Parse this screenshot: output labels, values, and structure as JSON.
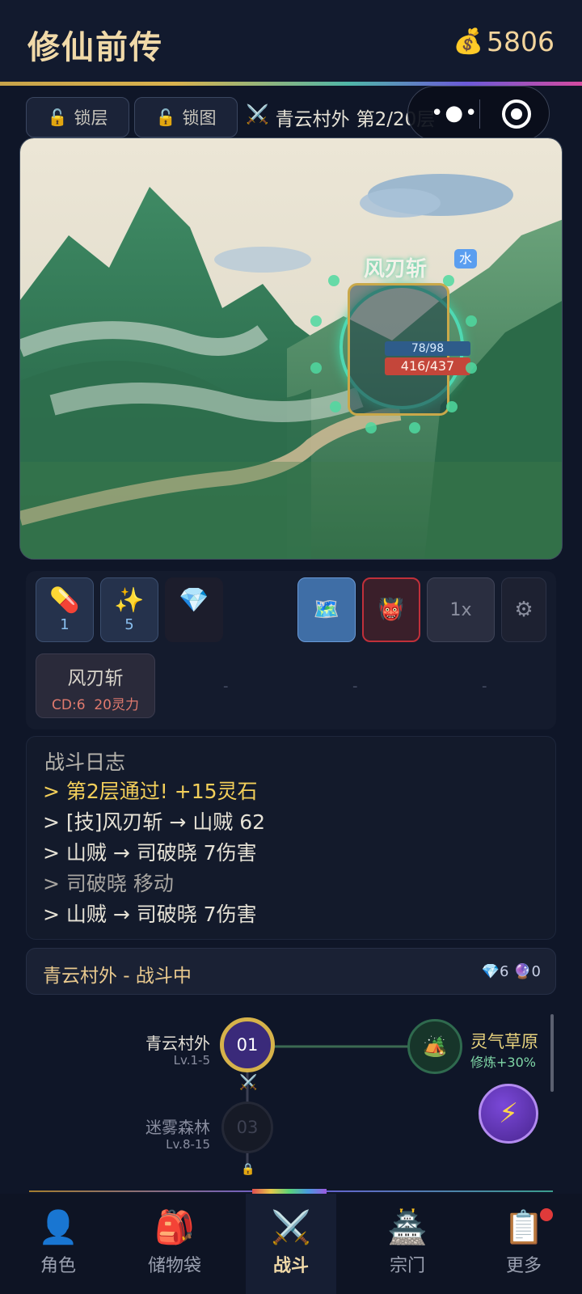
{
  "header": {
    "title": "修仙前传",
    "coin_icon": "money-bag-icon",
    "coins": "5806"
  },
  "top_controls": {
    "lock_floor": "锁层",
    "lock_map": "锁图",
    "stage_name": "青云村外",
    "stage_progress": "第2/20层"
  },
  "scene": {
    "skill_text": "风刃斩",
    "element": "水",
    "mp": "78/98",
    "hp": "416/437"
  },
  "items": [
    {
      "icon": "pill-icon",
      "count": "1"
    },
    {
      "icon": "sparkle-icon",
      "count": "5"
    },
    {
      "icon": "diamond-icon",
      "count": ""
    }
  ],
  "controls": {
    "speed": "1x"
  },
  "skills": {
    "slot1": {
      "name": "风刃斩",
      "cd": "CD:6",
      "cost": "20灵力"
    },
    "empty": "-"
  },
  "log": {
    "title": "战斗日志",
    "lines": [
      {
        "text": "> 第2层通过! +15灵石",
        "color": "#f3cf5a"
      },
      {
        "text": "> [技]风刃斩 → 山贼 62",
        "color": "#e6e2d6"
      },
      {
        "text": "> 山贼 → 司破晓 7伤害",
        "color": "#e6e2d6"
      },
      {
        "text": "> 司破晓 移动",
        "color": "#a7a4a0"
      },
      {
        "text": "> 山贼 → 司破晓 7伤害",
        "color": "#e6e2d6"
      }
    ]
  },
  "status": {
    "location": "青云村外 - 战斗中",
    "gems": "6",
    "orbs": "0"
  },
  "map": {
    "nodes": [
      {
        "name": "青云村外",
        "level": "Lv.1-5",
        "id": "01"
      },
      {
        "name": "迷雾森林",
        "level": "Lv.8-15",
        "id": "03"
      }
    ],
    "side_node": {
      "name": "灵气草原",
      "bonus": "修炼+30%"
    }
  },
  "nav": [
    {
      "label": "角色",
      "icon": "person-icon"
    },
    {
      "label": "储物袋",
      "icon": "backpack-icon"
    },
    {
      "label": "战斗",
      "icon": "crossed-swords-icon"
    },
    {
      "label": "宗门",
      "icon": "pagoda-icon"
    },
    {
      "label": "更多",
      "icon": "clipboard-icon"
    }
  ],
  "colors": {
    "accent_gold": "#f0d9a8",
    "hp_red": "#c4463a",
    "mp_blue": "#2e5c8a",
    "ring_green": "#4fd8b2"
  }
}
